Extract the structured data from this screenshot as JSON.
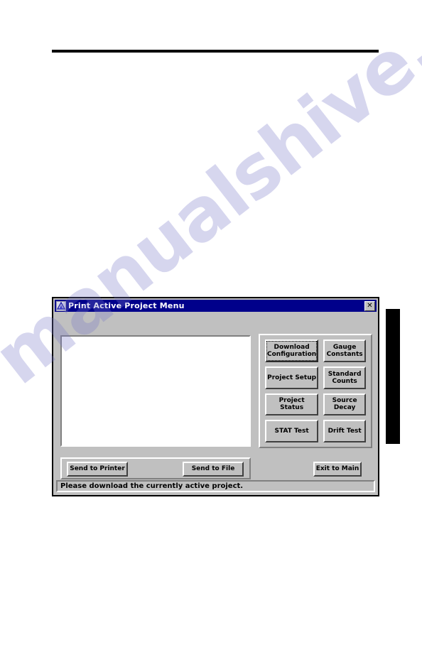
{
  "page": {
    "rule_present": true,
    "edge_tab_present": true,
    "watermark_text": "manualshive.com",
    "watermark_color": "#7876c8"
  },
  "dialog": {
    "title": "Print Active Project Menu",
    "icon": "pyramid-logo-icon",
    "close_label": "✕",
    "titlebar_color": "#00008B",
    "face_color": "#C0C0C0",
    "preview_pane": {
      "name": "print-preview-pane",
      "content": "",
      "background": "#FFFFFF"
    },
    "actions": [
      {
        "id": "download-configuration",
        "label": "Download\nConfiguration",
        "focused": true
      },
      {
        "id": "gauge-constants",
        "label": "Gauge\nConstants",
        "focused": false
      },
      {
        "id": "project-setup",
        "label": "Project Setup",
        "focused": false
      },
      {
        "id": "standard-counts",
        "label": "Standard\nCounts",
        "focused": false
      },
      {
        "id": "project-status",
        "label": "Project Status",
        "focused": false
      },
      {
        "id": "source-decay",
        "label": "Source Decay",
        "focused": false
      },
      {
        "id": "stat-test",
        "label": "STAT Test",
        "focused": false
      },
      {
        "id": "drift-test",
        "label": "Drift Test",
        "focused": false
      }
    ],
    "footer": {
      "send_to_printer": "Send to Printer",
      "send_to_file": "Send to File",
      "exit_to_main": "Exit to Main"
    },
    "statusbar": {
      "message": "Please download the currently active project."
    }
  }
}
